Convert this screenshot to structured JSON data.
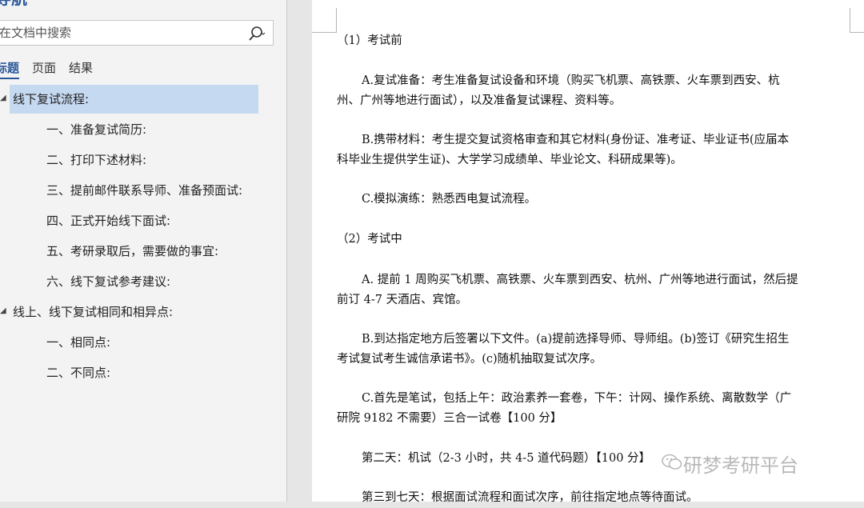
{
  "nav": {
    "title": "导航",
    "search_placeholder": "在文档中搜索",
    "tabs": [
      "标题",
      "页面",
      "结果"
    ],
    "items": [
      {
        "label": "线下复试流程:"
      },
      {
        "label": "一、准备复试简历:"
      },
      {
        "label": "二、打印下述材料:"
      },
      {
        "label": "三、提前邮件联系导师、准备预面试:"
      },
      {
        "label": "四、正式开始线下面试:"
      },
      {
        "label": "五、考研录取后，需要做的事宜:"
      },
      {
        "label": "六、线下复试参考建议:"
      },
      {
        "label": "线上、线下复试相同和相异点:"
      },
      {
        "label": "一、相同点:"
      },
      {
        "label": "二、不同点:"
      }
    ]
  },
  "document": {
    "lines": [
      "（1）考试前",
      "A.复试准备：考生准备复试设备和环境（购买飞机票、高铁票、火车票到西安、杭",
      "州、广州等地进行面试），以及准备复试课程、资料等。",
      "B.携带材料：考生提交复试资格审查和其它材料(身份证、准考证、毕业证书(应届本",
      "科毕业生提供学生证)、大学学习成绩单、毕业论文、科研成果等)。",
      "C.模拟演练：熟悉西电复试流程。",
      "（2）考试中",
      "A. 提前 1 周购买飞机票、高铁票、火车票到西安、杭州、广州等地进行面试，然后提",
      "前订 4-7 天酒店、宾馆。",
      "B.到达指定地方后签署以下文件。(a)提前选择导师、导师组。(b)签订《研究生招生",
      "考试复试考生诚信承诺书》。(c)随机抽取复试次序。",
      "C.首先是笔试，包括上午：政治素养一套卷，下午：计网、操作系统、离散数学（广",
      "研院 9182 不需要）三合一试卷【100 分】",
      "第二天：机试（2-3 小时，共 4-5 道代码题）【100 分】",
      "第三到七天：根据面试流程和面试次序，前往指定地点等待面试。"
    ]
  },
  "watermark": "研梦考研平台"
}
